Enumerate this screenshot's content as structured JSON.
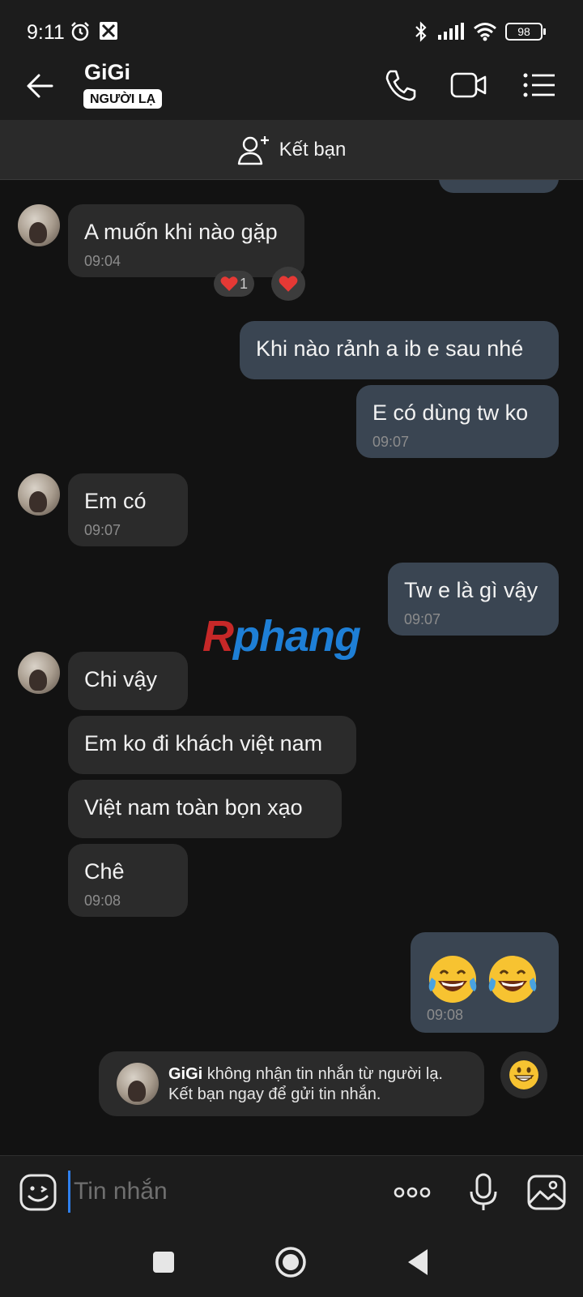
{
  "status_bar": {
    "time": "9:11",
    "battery": "98"
  },
  "header": {
    "contact_name": "GiGi",
    "badge": "NGƯỜI LẠ"
  },
  "add_friend": {
    "label": "Kết bạn"
  },
  "messages": [
    {
      "direction": "in",
      "text": "A muốn khi nào gặp",
      "time": "09:04",
      "reaction_count": "1"
    },
    {
      "direction": "out",
      "text": "Khi nào rảnh a ib e sau nhé",
      "time": ""
    },
    {
      "direction": "out",
      "text": "E có dùng tw ko",
      "time": "09:07"
    },
    {
      "direction": "in",
      "text": "Em có",
      "time": "09:07"
    },
    {
      "direction": "out",
      "text": "Tw e là gì vậy",
      "time": "09:07"
    },
    {
      "direction": "in",
      "text": "Chi vậy",
      "time": ""
    },
    {
      "direction": "in",
      "text": "Em ko đi khách việt nam",
      "time": ""
    },
    {
      "direction": "in",
      "text": "Việt nam toàn bọn xạo",
      "time": ""
    },
    {
      "direction": "in",
      "text": "Chê",
      "time": "09:08"
    },
    {
      "direction": "out",
      "text": "😂😂",
      "time": "09:08"
    }
  ],
  "watermark": {
    "first": "R",
    "rest": "phang"
  },
  "notice": {
    "name": "GiGi",
    "line1": " không nhận tin nhắn từ người lạ.",
    "line2": "Kết bạn ngay để gửi tin nhắn."
  },
  "input": {
    "placeholder": "Tin nhắn"
  },
  "colors": {
    "bubble_in": "#2b2b2b",
    "bubble_out": "#3a4552",
    "background": "#121212",
    "accent": "#2f80ed",
    "heart": "#e53935"
  }
}
